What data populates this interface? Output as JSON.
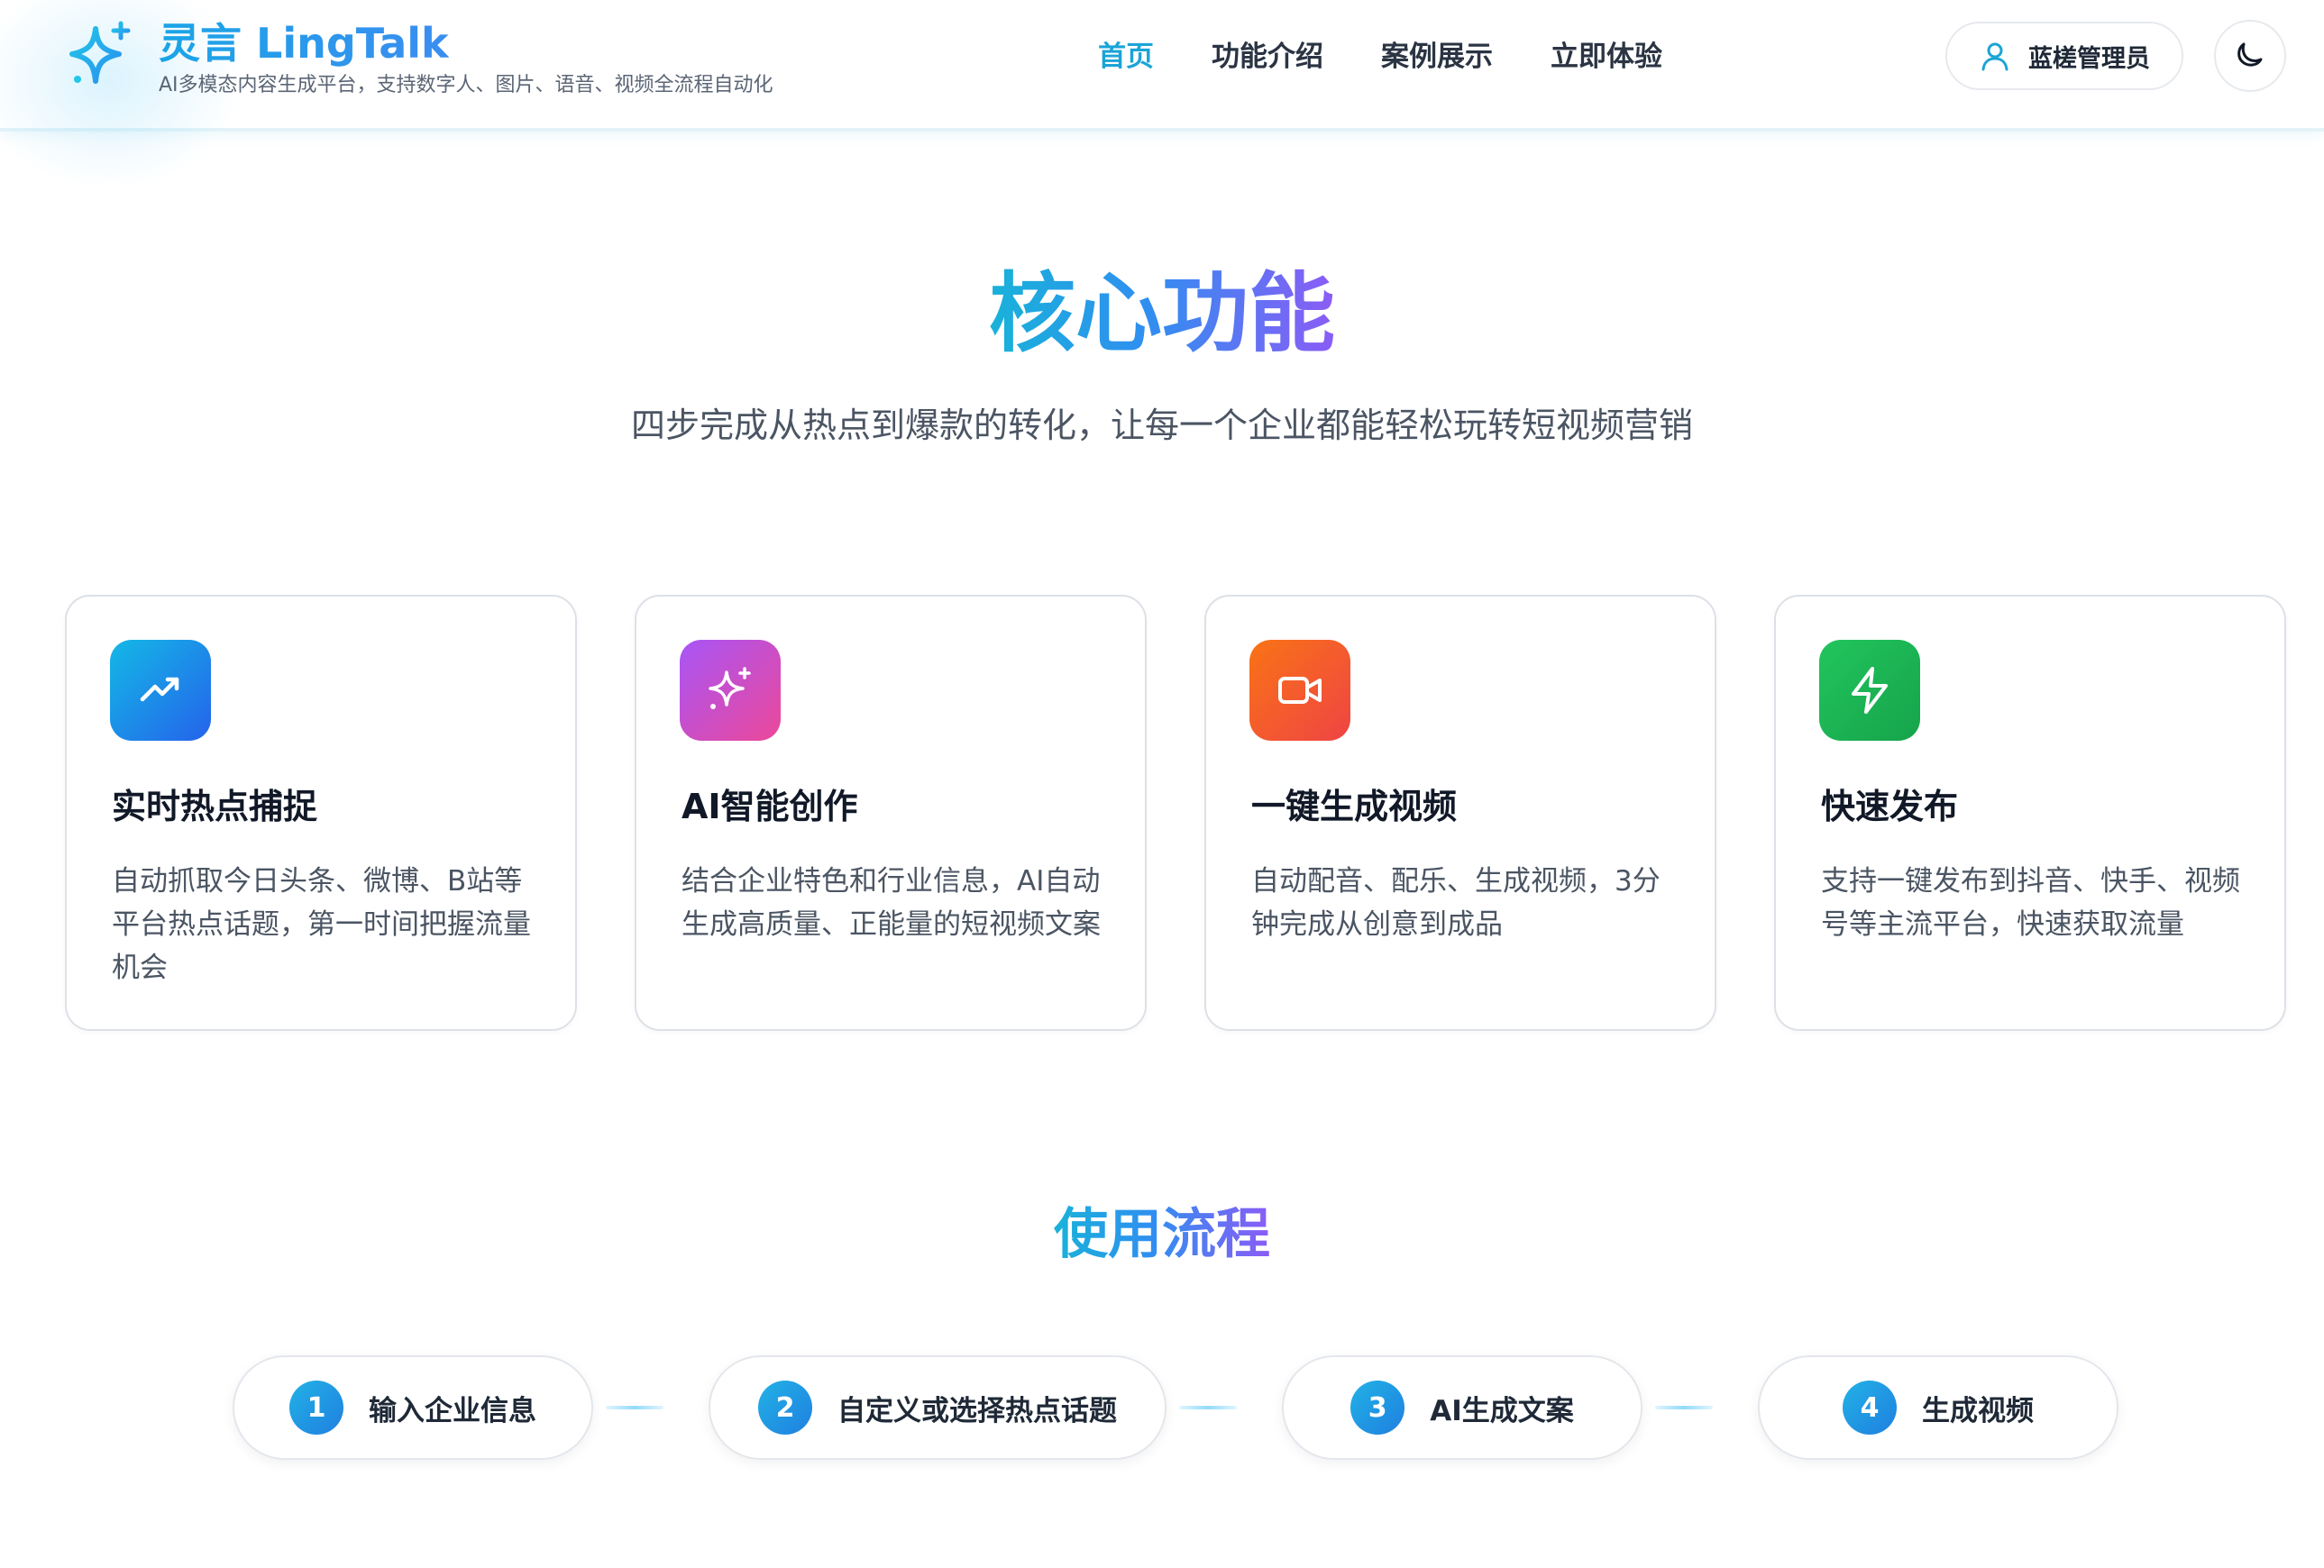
{
  "header": {
    "brand_title": "灵言 LingTalk",
    "brand_subtitle": "AI多模态内容生成平台，支持数字人、图片、语音、视频全流程自动化",
    "nav": [
      {
        "label": "首页",
        "active": true
      },
      {
        "label": "功能介绍",
        "active": false
      },
      {
        "label": "案例展示",
        "active": false
      },
      {
        "label": "立即体验",
        "active": false
      }
    ],
    "user_name": "蓝槎管理员",
    "icons": {
      "logo": "sparkle-icon",
      "user": "user-icon",
      "theme": "moon-icon"
    },
    "accent_color": "#1ba4d6"
  },
  "core": {
    "title": "核心功能",
    "subtitle": "四步完成从热点到爆款的转化，让每一个企业都能轻松玩转短视频营销",
    "cards": [
      {
        "title": "实时热点捕捉",
        "description": "自动抓取今日头条、微博、B站等平台热点话题，第一时间把握流量机会",
        "icon": "trending-up-icon",
        "color_from": "#14b8e6",
        "color_to": "#2563eb"
      },
      {
        "title": "AI智能创作",
        "description": "结合企业特色和行业信息，AI自动生成高质量、正能量的短视频文案",
        "icon": "sparkles-icon",
        "color_from": "#a855f7",
        "color_to": "#ec4899"
      },
      {
        "title": "一键生成视频",
        "description": "自动配音、配乐、生成视频，3分钟完成从创意到成品",
        "icon": "video-camera-icon",
        "color_from": "#f97316",
        "color_to": "#ef4444"
      },
      {
        "title": "快速发布",
        "description": "支持一键发布到抖音、快手、视频号等主流平台，快速获取流量",
        "icon": "lightning-icon",
        "color_from": "#22c55e",
        "color_to": "#16a34a"
      }
    ]
  },
  "flow": {
    "title": "使用流程",
    "steps": [
      {
        "number": "1",
        "label": "输入企业信息"
      },
      {
        "number": "2",
        "label": "自定义或选择热点话题"
      },
      {
        "number": "3",
        "label": "AI生成文案"
      },
      {
        "number": "4",
        "label": "生成视频"
      }
    ]
  }
}
